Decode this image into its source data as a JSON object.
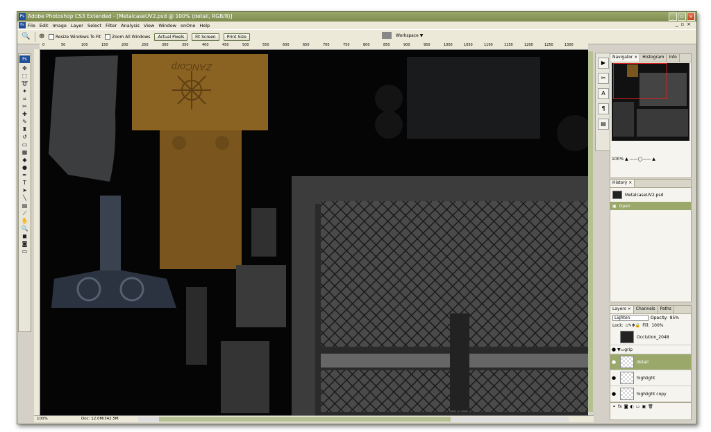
{
  "window": {
    "title": "Adobe Photoshop CS3 Extended - [MetalcaseUV2.psd @ 100% (detail, RGB/8)]",
    "app_icon": "Ps"
  },
  "menu": {
    "items": [
      "File",
      "Edit",
      "Image",
      "Layer",
      "Select",
      "Filter",
      "Analysis",
      "View",
      "Window",
      "onOne",
      "Help"
    ]
  },
  "options": {
    "resize_windows": "Resize Windows To Fit",
    "zoom_all": "Zoom All Windows",
    "actual_pixels": "Actual Pixels",
    "fit_screen": "Fit Screen",
    "print_size": "Print Size",
    "workspace": "Workspace ▼"
  },
  "toolbox": {
    "logo": "Ps"
  },
  "ruler": {
    "ticks": [
      "0",
      "50",
      "100",
      "150",
      "200",
      "250",
      "300",
      "350",
      "400",
      "450",
      "500",
      "550",
      "600",
      "650",
      "700",
      "750",
      "800",
      "850",
      "900",
      "950",
      "1000",
      "1050",
      "1100",
      "1150",
      "1200",
      "1250",
      "1300"
    ]
  },
  "canvas": {
    "brand_text": "ZANCorp"
  },
  "status": {
    "zoom": "100%",
    "doc": "Doc: 12.0M/342.5M"
  },
  "navigator": {
    "tabs": [
      "Navigator ×",
      "Histogram",
      "Info"
    ],
    "zoom": "100%"
  },
  "history": {
    "tab": "History ×",
    "snapshot": "MetalcaseUV2.psd",
    "items": [
      "Open"
    ]
  },
  "layers": {
    "tabs": [
      "Layers ×",
      "Channels",
      "Paths"
    ],
    "blend_mode": "Lighten",
    "opacity_label": "Opacity:",
    "opacity": "85%",
    "lock_label": "Lock:",
    "fill_label": "Fill:",
    "fill": "100%",
    "rows": [
      {
        "name": "Occlution_2048",
        "selected": false
      },
      {
        "name": "grip",
        "selected": false,
        "group": true
      },
      {
        "name": "detail",
        "selected": true
      },
      {
        "name": "highlight",
        "selected": false
      },
      {
        "name": "highlight copy",
        "selected": false
      }
    ]
  }
}
